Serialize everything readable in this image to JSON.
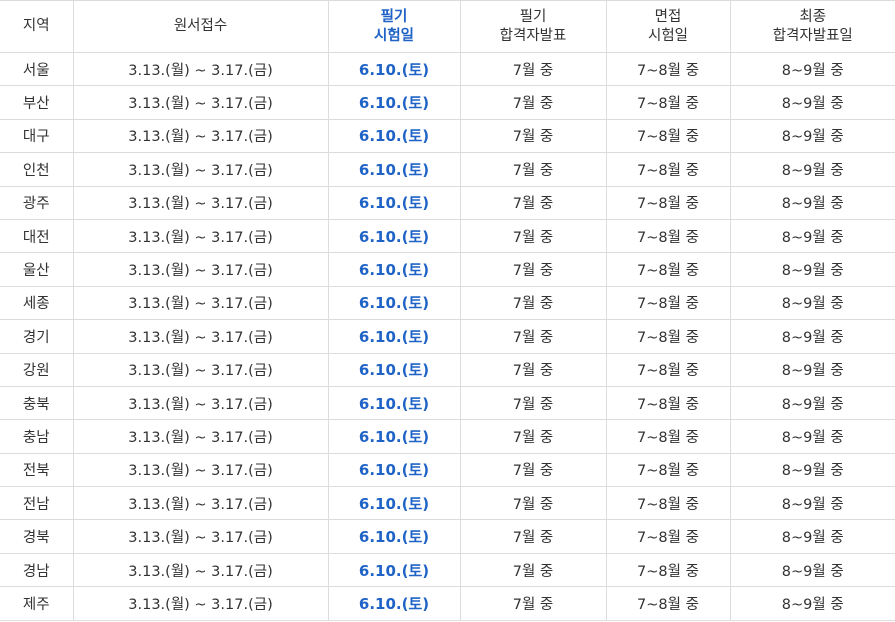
{
  "header": {
    "region": "지역",
    "application": "원서접수",
    "written_exam": [
      "필기",
      "시험일"
    ],
    "written_result": [
      "필기",
      "합격자발표"
    ],
    "interview": [
      "면접",
      "시험일"
    ],
    "final_result": [
      "최종",
      "합격자발표일"
    ]
  },
  "highlight_color": "#1f63c6",
  "rows": [
    {
      "region": "서울",
      "application": "3.13.(월) ~ 3.17.(금)",
      "written_exam": "6.10.(토)",
      "written_result": "7월 중",
      "interview": "7~8월 중",
      "final_result": "8~9월 중"
    },
    {
      "region": "부산",
      "application": "3.13.(월) ~ 3.17.(금)",
      "written_exam": "6.10.(토)",
      "written_result": "7월 중",
      "interview": "7~8월 중",
      "final_result": "8~9월 중"
    },
    {
      "region": "대구",
      "application": "3.13.(월) ~ 3.17.(금)",
      "written_exam": "6.10.(토)",
      "written_result": "7월 중",
      "interview": "7~8월 중",
      "final_result": "8~9월 중"
    },
    {
      "region": "인천",
      "application": "3.13.(월) ~ 3.17.(금)",
      "written_exam": "6.10.(토)",
      "written_result": "7월 중",
      "interview": "7~8월 중",
      "final_result": "8~9월 중"
    },
    {
      "region": "광주",
      "application": "3.13.(월) ~ 3.17.(금)",
      "written_exam": "6.10.(토)",
      "written_result": "7월 중",
      "interview": "7~8월 중",
      "final_result": "8~9월 중"
    },
    {
      "region": "대전",
      "application": "3.13.(월) ~ 3.17.(금)",
      "written_exam": "6.10.(토)",
      "written_result": "7월 중",
      "interview": "7~8월 중",
      "final_result": "8~9월 중"
    },
    {
      "region": "울산",
      "application": "3.13.(월) ~ 3.17.(금)",
      "written_exam": "6.10.(토)",
      "written_result": "7월 중",
      "interview": "7~8월 중",
      "final_result": "8~9월 중"
    },
    {
      "region": "세종",
      "application": "3.13.(월) ~ 3.17.(금)",
      "written_exam": "6.10.(토)",
      "written_result": "7월 중",
      "interview": "7~8월 중",
      "final_result": "8~9월 중"
    },
    {
      "region": "경기",
      "application": "3.13.(월) ~ 3.17.(금)",
      "written_exam": "6.10.(토)",
      "written_result": "7월 중",
      "interview": "7~8월 중",
      "final_result": "8~9월 중"
    },
    {
      "region": "강원",
      "application": "3.13.(월) ~ 3.17.(금)",
      "written_exam": "6.10.(토)",
      "written_result": "7월 중",
      "interview": "7~8월 중",
      "final_result": "8~9월 중"
    },
    {
      "region": "충북",
      "application": "3.13.(월) ~ 3.17.(금)",
      "written_exam": "6.10.(토)",
      "written_result": "7월 중",
      "interview": "7~8월 중",
      "final_result": "8~9월 중"
    },
    {
      "region": "충남",
      "application": "3.13.(월) ~ 3.17.(금)",
      "written_exam": "6.10.(토)",
      "written_result": "7월 중",
      "interview": "7~8월 중",
      "final_result": "8~9월 중"
    },
    {
      "region": "전북",
      "application": "3.13.(월) ~ 3.17.(금)",
      "written_exam": "6.10.(토)",
      "written_result": "7월 중",
      "interview": "7~8월 중",
      "final_result": "8~9월 중"
    },
    {
      "region": "전남",
      "application": "3.13.(월) ~ 3.17.(금)",
      "written_exam": "6.10.(토)",
      "written_result": "7월 중",
      "interview": "7~8월 중",
      "final_result": "8~9월 중"
    },
    {
      "region": "경북",
      "application": "3.13.(월) ~ 3.17.(금)",
      "written_exam": "6.10.(토)",
      "written_result": "7월 중",
      "interview": "7~8월 중",
      "final_result": "8~9월 중"
    },
    {
      "region": "경남",
      "application": "3.13.(월) ~ 3.17.(금)",
      "written_exam": "6.10.(토)",
      "written_result": "7월 중",
      "interview": "7~8월 중",
      "final_result": "8~9월 중"
    },
    {
      "region": "제주",
      "application": "3.13.(월) ~ 3.17.(금)",
      "written_exam": "6.10.(토)",
      "written_result": "7월 중",
      "interview": "7~8월 중",
      "final_result": "8~9월 중"
    }
  ]
}
